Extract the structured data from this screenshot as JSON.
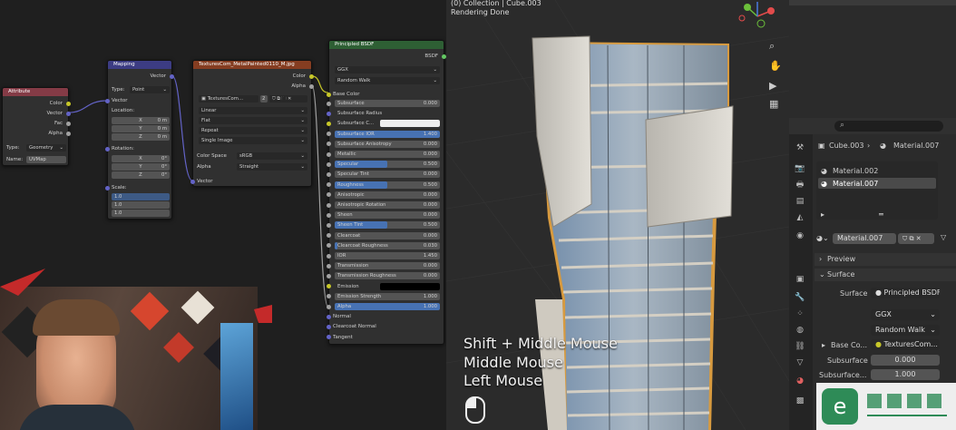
{
  "viewport": {
    "collection": "(0) Collection | Cube.003",
    "status": "Rendering Done",
    "hud": [
      "Shift + Middle Mouse",
      "Middle Mouse",
      "Left Mouse"
    ]
  },
  "attribute_node": {
    "title": "Attribute",
    "outs": [
      "Color",
      "Vector",
      "Fac",
      "Alpha"
    ],
    "type_label": "Type:",
    "type_value": "Geometry",
    "name_label": "Name:",
    "name_value": "UVMap"
  },
  "mapping_node": {
    "title": "Mapping",
    "out": "Vector",
    "type_label": "Type:",
    "type_value": "Point",
    "vector": "Vector",
    "location": "Location:",
    "loc": [
      {
        "a": "X",
        "v": "0 m"
      },
      {
        "a": "Y",
        "v": "0 m"
      },
      {
        "a": "Z",
        "v": "0 m"
      }
    ],
    "rotation": "Rotation:",
    "rot": [
      {
        "a": "X",
        "v": "0°"
      },
      {
        "a": "Y",
        "v": "0°"
      },
      {
        "a": "Z",
        "v": "0°"
      }
    ],
    "scale": "Scale:",
    "scl": [
      "1.0",
      "1.0",
      "1.0"
    ]
  },
  "texture_node": {
    "title": "TexturesCom_MetalPainted0110_M.jpg",
    "outs": [
      "Color",
      "Alpha"
    ],
    "image": "TexturesCom...",
    "users": "2",
    "opts": [
      "Linear",
      "Flat",
      "Repeat",
      "Single Image"
    ],
    "cs_label": "Color Space",
    "cs_value": "sRGB",
    "al_label": "Alpha",
    "al_value": "Straight",
    "vector": "Vector"
  },
  "bsdf_node": {
    "title": "Principled BSDF",
    "out": "BSDF",
    "dist": "GGX",
    "sss": "Random Walk",
    "base": "Base Color",
    "rows": [
      {
        "l": "Subsurface",
        "v": "0.000",
        "f": 0
      },
      {
        "l": "Subsurface Radius",
        "v": "",
        "f": 0
      },
      {
        "l": "Subsurface C...",
        "v": "",
        "f": 0
      },
      {
        "l": "Subsurface IOR",
        "v": "1.400",
        "f": 1
      },
      {
        "l": "Subsurface Anisotropy",
        "v": "0.000",
        "f": 0
      },
      {
        "l": "Metallic",
        "v": "0.000",
        "f": 0
      },
      {
        "l": "Specular",
        "v": "0.500",
        "f": 0.5
      },
      {
        "l": "Specular Tint",
        "v": "0.000",
        "f": 0
      },
      {
        "l": "Roughness",
        "v": "0.500",
        "f": 0.5
      },
      {
        "l": "Anisotropic",
        "v": "0.000",
        "f": 0
      },
      {
        "l": "Anisotropic Rotation",
        "v": "0.000",
        "f": 0
      },
      {
        "l": "Sheen",
        "v": "0.000",
        "f": 0
      },
      {
        "l": "Sheen Tint",
        "v": "0.500",
        "f": 0.5
      },
      {
        "l": "Clearcoat",
        "v": "0.000",
        "f": 0
      },
      {
        "l": "Clearcoat Roughness",
        "v": "0.030",
        "f": 0.03
      },
      {
        "l": "IOR",
        "v": "1.450",
        "f": 0
      },
      {
        "l": "Transmission",
        "v": "0.000",
        "f": 0
      },
      {
        "l": "Transmission Roughness",
        "v": "0.000",
        "f": 0
      },
      {
        "l": "Emission",
        "v": "",
        "f": 0
      },
      {
        "l": "Emission Strength",
        "v": "1.000",
        "f": 0
      },
      {
        "l": "Alpha",
        "v": "1.000",
        "f": 1
      }
    ],
    "tail": [
      "Normal",
      "Clearcoat Normal",
      "Tangent"
    ]
  },
  "props": {
    "breadcrumb_obj": "Cube.003",
    "breadcrumb_mat": "Material.007",
    "slots": [
      "Material.002",
      "Material.007"
    ],
    "material": "Material.007",
    "preview": "Preview",
    "surface_panel": "Surface",
    "surface_label": "Surface",
    "surface_value": "Principled BSDF",
    "dist": "GGX",
    "sss": "Random Walk",
    "base_label": "Base Co...",
    "base_value": "TexturesCom...",
    "sub_label": "Subsurface",
    "sub_value": "0.000",
    "subr_label": "Subsurface...",
    "subr_value": "1.000"
  },
  "colors": {
    "header_attr": "#843b46",
    "header_map": "#3c3c83",
    "header_tex": "#853d21",
    "header_bsdf": "#2e5f34",
    "socket_color": "#c7c729",
    "socket_vector": "#6363c7",
    "socket_float": "#a1a1a1",
    "accent": "#4772b3"
  }
}
